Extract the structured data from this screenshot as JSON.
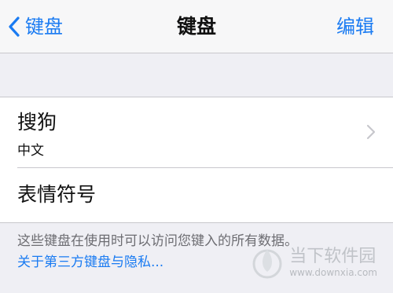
{
  "navbar": {
    "back_label": "键盘",
    "title": "键盘",
    "edit_label": "编辑"
  },
  "keyboards": [
    {
      "name": "搜狗",
      "subtitle": "中文",
      "icon": "chevron-right-icon"
    },
    {
      "name": "表情符号"
    }
  ],
  "footer": {
    "note": "这些键盘在使用时可以访问您键入的所有数据。",
    "link": "关于第三方键盘与隐私..."
  },
  "watermark": {
    "name": "当下软件园",
    "url": "www.downxia.com"
  },
  "colors": {
    "accent": "#1a7bf2",
    "background": "#efeff4",
    "separator": "#c8c7cc"
  }
}
